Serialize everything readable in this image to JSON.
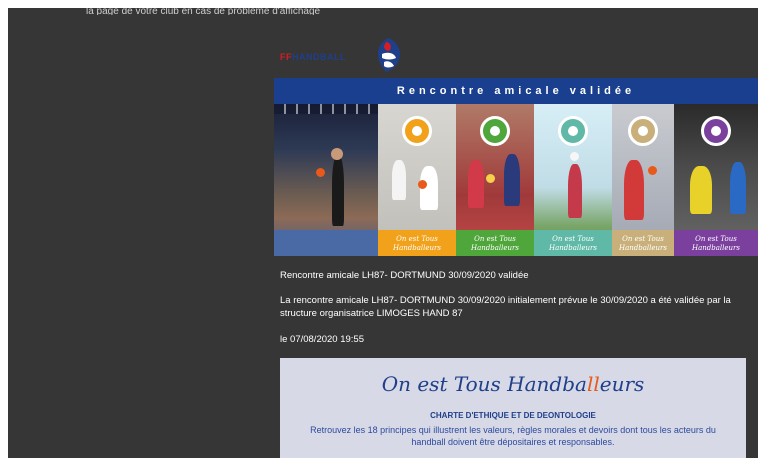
{
  "top_text": "la page de votre club en cas de problème d'affichage",
  "brand": {
    "part1": "FF",
    "part2": "HANDBALL"
  },
  "banner_title": "Rencontre amicale validée",
  "photo_strips": [
    {
      "label": "",
      "color": "#ffffff"
    },
    {
      "label": "On est Tous\nHandballeurs",
      "color": "#f2a21a"
    },
    {
      "label": "On est Tous\nHandballeurs",
      "color": "#4fa63a"
    },
    {
      "label": "On est Tous\nHandballeurs",
      "color": "#5fb9a6"
    },
    {
      "label": "On est Tous\nHandballeurs",
      "color": "#c9b07a"
    },
    {
      "label": "On est Tous\nHandballeurs",
      "color": "#7b3f9e"
    }
  ],
  "message": {
    "title": "Rencontre amicale LH87- DORTMUND 30/09/2020 validée",
    "body": "La rencontre amicale LH87- DORTMUND 30/09/2020 initialement prévue le 30/09/2020 a été validée par la structure organisatrice LIMOGES HAND 87",
    "date": "le 07/08/2020 19:55"
  },
  "charter": {
    "title_a": "On est Tous Handba",
    "title_accent": "ll",
    "title_b": "eurs",
    "subtitle": "CHARTE D'ETHIQUE ET DE DEONTOLOGIE",
    "text": "Retrouvez les 18 principes qui illustrent les valeurs, règles morales et devoirs dont tous les acteurs du handball doivent être dépositaires et responsables."
  }
}
